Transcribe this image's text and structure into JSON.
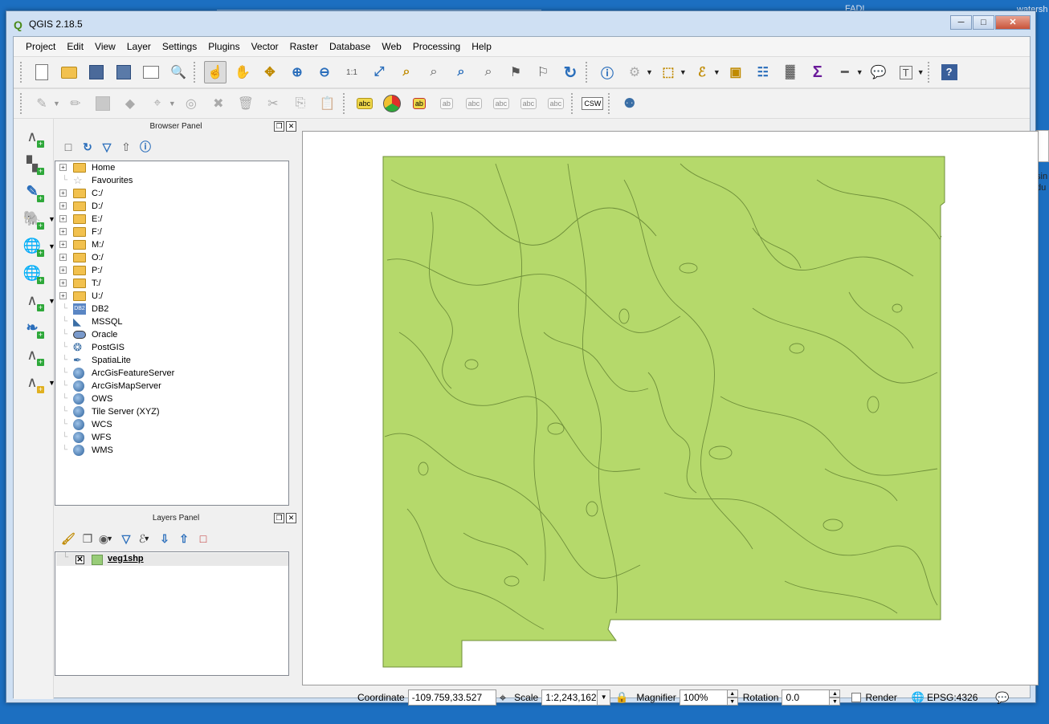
{
  "desktop": {
    "right_text_top": "watersh",
    "right_text_mid_top": "FADI",
    "side_text_1": "sin",
    "side_text_2": "du"
  },
  "window": {
    "title": "QGIS 2.18.5",
    "minimize": "─",
    "maximize": "□",
    "close": "✕"
  },
  "menubar": [
    "Project",
    "Edit",
    "View",
    "Layer",
    "Settings",
    "Plugins",
    "Vector",
    "Raster",
    "Database",
    "Web",
    "Processing",
    "Help"
  ],
  "browser_panel": {
    "title": "Browser Panel",
    "items": [
      {
        "label": "Home",
        "icon": "folder-icon",
        "expandable": true
      },
      {
        "label": "Favourites",
        "icon": "star-icon",
        "expandable": false
      },
      {
        "label": "C:/",
        "icon": "folder-icon",
        "expandable": true
      },
      {
        "label": "D:/",
        "icon": "folder-icon",
        "expandable": true
      },
      {
        "label": "E:/",
        "icon": "folder-icon",
        "expandable": true
      },
      {
        "label": "F:/",
        "icon": "folder-icon",
        "expandable": true
      },
      {
        "label": "M:/",
        "icon": "folder-icon",
        "expandable": true
      },
      {
        "label": "O:/",
        "icon": "folder-icon",
        "expandable": true
      },
      {
        "label": "P:/",
        "icon": "folder-icon",
        "expandable": true
      },
      {
        "label": "T:/",
        "icon": "folder-icon",
        "expandable": true
      },
      {
        "label": "U:/",
        "icon": "folder-icon",
        "expandable": true
      },
      {
        "label": "DB2",
        "icon": "db2-icon",
        "expandable": false
      },
      {
        "label": "MSSQL",
        "icon": "mssql-icon",
        "expandable": false
      },
      {
        "label": "Oracle",
        "icon": "oracle-icon",
        "expandable": false
      },
      {
        "label": "PostGIS",
        "icon": "postgis-icon",
        "expandable": false
      },
      {
        "label": "SpatiaLite",
        "icon": "spatialite-icon",
        "expandable": false
      },
      {
        "label": "ArcGisFeatureServer",
        "icon": "globe-icon",
        "expandable": false
      },
      {
        "label": "ArcGisMapServer",
        "icon": "globe-icon",
        "expandable": false
      },
      {
        "label": "OWS",
        "icon": "globe-icon",
        "expandable": false
      },
      {
        "label": "Tile Server (XYZ)",
        "icon": "globe-icon",
        "expandable": false
      },
      {
        "label": "WCS",
        "icon": "globe-icon",
        "expandable": false
      },
      {
        "label": "WFS",
        "icon": "globe-icon",
        "expandable": false
      },
      {
        "label": "WMS",
        "icon": "globe-icon",
        "expandable": false
      }
    ]
  },
  "layers_panel": {
    "title": "Layers Panel",
    "layers": [
      {
        "name": "veg1shp",
        "visible": true,
        "fill_color": "#98cc78"
      }
    ]
  },
  "map": {
    "fill_color": "#b5d96b",
    "stroke_color": "#6f8f3a"
  },
  "statusbar": {
    "coordinate_label": "Coordinate",
    "coordinate_value": "-109.759,33.527",
    "scale_label": "Scale",
    "scale_value": "1:2,243,162",
    "magnifier_label": "Magnifier",
    "magnifier_value": "100%",
    "rotation_label": "Rotation",
    "rotation_value": "0.0",
    "render_label": "Render",
    "crs": "EPSG:4326"
  }
}
